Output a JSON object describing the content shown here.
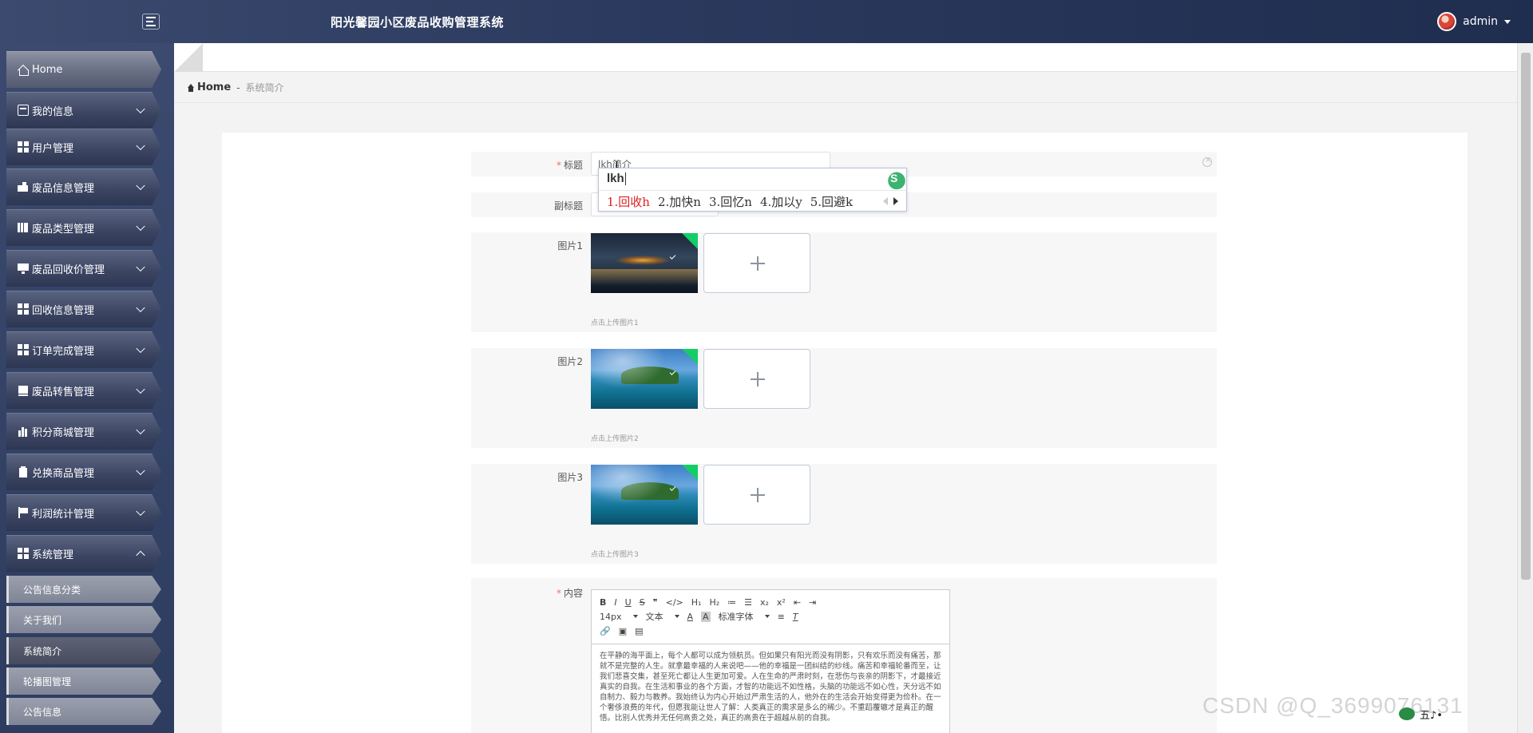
{
  "header": {
    "app_title": "阳光馨园小区废品收购管理系统",
    "user_name": "admin"
  },
  "sidebar": {
    "items": [
      {
        "label": "Home",
        "icon": "home-icon"
      },
      {
        "label": "我的信息",
        "icon": "id-card-icon"
      },
      {
        "label": "用户管理",
        "icon": "grid-icon"
      },
      {
        "label": "废品信息管理",
        "icon": "hand-icon"
      },
      {
        "label": "废品类型管理",
        "icon": "columns-icon"
      },
      {
        "label": "废品回收价管理",
        "icon": "monitor-icon"
      },
      {
        "label": "回收信息管理",
        "icon": "grid-icon"
      },
      {
        "label": "订单完成管理",
        "icon": "grid-icon"
      },
      {
        "label": "废品转售管理",
        "icon": "book-icon"
      },
      {
        "label": "积分商城管理",
        "icon": "bar-chart-icon"
      },
      {
        "label": "兑换商品管理",
        "icon": "clipboard-icon"
      },
      {
        "label": "利润统计管理",
        "icon": "flag-icon"
      },
      {
        "label": "系统管理",
        "icon": "grid-icon"
      }
    ],
    "sub_items": [
      {
        "label": "公告信息分类"
      },
      {
        "label": "关于我们"
      },
      {
        "label": "系统简介"
      },
      {
        "label": "轮播图管理"
      },
      {
        "label": "公告信息"
      }
    ]
  },
  "breadcrumb": {
    "home": "Home",
    "separator": "-",
    "current": "系统简介"
  },
  "form": {
    "title_label": "标题",
    "title_value": "lkh简介",
    "subtitle_label": "副标题",
    "image1_label": "图片1",
    "image1_tip": "点击上传图片1",
    "image2_label": "图片2",
    "image2_tip": "点击上传图片2",
    "image3_label": "图片3",
    "image3_tip": "点击上传图片3",
    "content_label": "内容",
    "content_text": "在平静的海平面上，每个人都可以成为领航员。但如果只有阳光而没有阴影，只有欢乐而没有痛苦，那就不是完整的人生。就拿最幸福的人来说吧——他的幸福是一团纠结的纱线。痛苦和幸福轮番而至，让我们悲喜交集，甚至死亡都让人生更加可爱。人在生命的严肃时刻，在悲伤与丧亲的阴影下，才最接近真实的自我。在生活和事业的各个方面，才智的功能远不如性格，头脑的功能远不如心性，天分远不如自制力、毅力与教养。我始终认为内心开始过严肃生活的人，他外在的生活会开始变得更为俭朴。在一个奢侈浪费的年代，但愿我能让世人了解：人类真正的需求是多么的稀少。不重蹈覆辙才是真正的醒悟。比别人优秀并无任何高贵之处，真正的高贵在于超越从前的自我。"
  },
  "ime": {
    "composition": "lkh",
    "candidates": [
      "1.回收h",
      "2.加快n",
      "3.回忆n",
      "4.加以y",
      "5.回避k"
    ]
  },
  "editor": {
    "font_size": "14px",
    "paragraph": "文本",
    "font_family": "标准字体",
    "buttons_row1": [
      "B",
      "I",
      "U",
      "S",
      "❞",
      "</>",
      "H₁",
      "H₂",
      "≔",
      "☰",
      "x₂",
      "x²",
      "⇤",
      "⇥"
    ]
  },
  "watermark": "CSDN @Q_3699076131",
  "tray": "五♪•"
}
